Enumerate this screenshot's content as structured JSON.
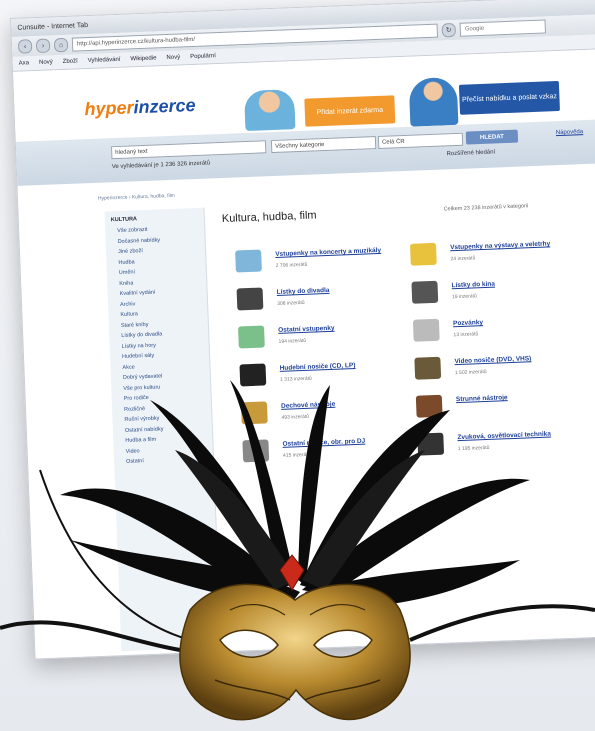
{
  "browser": {
    "title": "Ϲunsuite - Internet Tab",
    "url": "http://api.hyperinzerce.cz/kultura-hudba-film/",
    "search_placeholder": "Google",
    "bookmarks": [
      "Axa",
      "Nový",
      "Zboží",
      "Vyhledávání",
      "Wikipedie",
      "Nový",
      "Populární"
    ]
  },
  "banner": {
    "logo_left": "hyper",
    "logo_right": "inzerce",
    "promo1": "Přidat inzerát zdarma",
    "promo2": "Přečíst nabídku a poslat vzkaz"
  },
  "search": {
    "query": "hledaný text",
    "category": "Všechny kategorie",
    "region": "Celá ČR",
    "button": "HLEDAT",
    "advanced": "Rozšířené hledání",
    "count_text": "Ve vyhledávání je 1 236 326 inzerátů",
    "right_link": "Nápověda"
  },
  "breadcrumb": "Hyperinzerce › Kultura, hudba, film",
  "sidebar": {
    "heading": "KULTURA",
    "items": [
      "Vše zobrazit",
      "Dočasné nabídky",
      "Jiné zboží",
      "Hudba",
      "Umění",
      "Kniha",
      "Kvalitní vydání",
      "Archiv",
      "Kultura",
      "Staré knihy",
      "Lístky do divadla",
      "Lístky na hory",
      "Hudební sály",
      "Akce",
      "Dobrý vydavatel",
      "Vše pro kulturu",
      "Pro rodiče",
      "Rozličné",
      "Ruční výrobky",
      "Ostatní nabídky",
      "Hudba a film",
      "Video",
      "Ostatní"
    ]
  },
  "main": {
    "title": "Kultura, hudba, film",
    "subtitle": "Celkem 23 238 inzerátů v kategorii",
    "categories": [
      {
        "name": "Vstupenky na koncerty a muzikály",
        "count": "2 706 inzerátů"
      },
      {
        "name": "Vstupenky na výstavy a veletrhy",
        "count": "24 inzerátů"
      },
      {
        "name": "Lístky do divadla",
        "count": "308 inzerátů"
      },
      {
        "name": "Lístky do kina",
        "count": "19 inzerátů"
      },
      {
        "name": "Ostatní vstupenky",
        "count": "194 inzerátů"
      },
      {
        "name": "Pozvánky",
        "count": "13 inzerátů"
      },
      {
        "name": "Hudební nosiče (CD, LP)",
        "count": "1 313 inzerátů"
      },
      {
        "name": "Video nosiče (DVD, VHS)",
        "count": "1 502 inzerátů"
      },
      {
        "name": "Dechové nástroje",
        "count": "493 inzerátů"
      },
      {
        "name": "Strunné nástroje",
        "count": ""
      },
      {
        "name": "Ostatní nosiče, obr. pro DJ",
        "count": "415 inzerátů"
      },
      {
        "name": "Zvuková, osvětlovací technika",
        "count": "1 195 inzerátů"
      }
    ]
  },
  "colors": {
    "brand_orange": "#f07d10",
    "brand_blue": "#1e4fa8",
    "link": "#1d3f9a"
  }
}
